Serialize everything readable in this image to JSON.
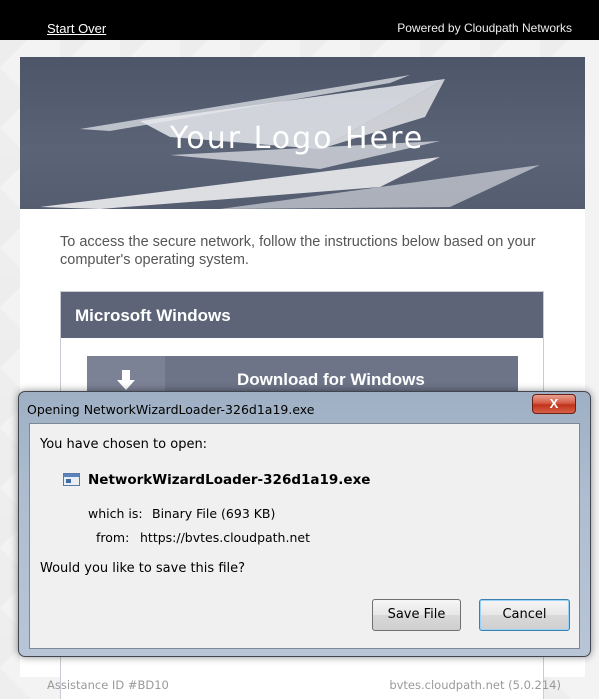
{
  "topbar": {
    "start_over": "Start Over",
    "powered_by": "Powered by Cloudpath Networks"
  },
  "logo": {
    "text": "Your Logo Here"
  },
  "intro": "To access the secure network, follow the instructions below based on your computer's operating system.",
  "os_section": {
    "title": "Microsoft Windows",
    "download_label": "Download for Windows"
  },
  "footer": {
    "assistance": "Assistance ID #BD10",
    "host": "bvtes.cloudpath.net (5.0.214)"
  },
  "dialog": {
    "title": "Opening NetworkWizardLoader-326d1a19.exe",
    "close_label": "X",
    "chosen": "You have chosen to open:",
    "filename": "NetworkWizardLoader-326d1a19.exe",
    "which_is_label": "which is:",
    "which_is_value": "Binary File (693 KB)",
    "from_label": "from:",
    "from_value": "https://bvtes.cloudpath.net",
    "question": "Would you like to save this file?",
    "save_label": "Save File",
    "cancel_label": "Cancel"
  },
  "colors": {
    "topbar": "#000000",
    "banner": "#5b6377",
    "os_header": "#5d6477",
    "download_button": "#6d7488"
  }
}
